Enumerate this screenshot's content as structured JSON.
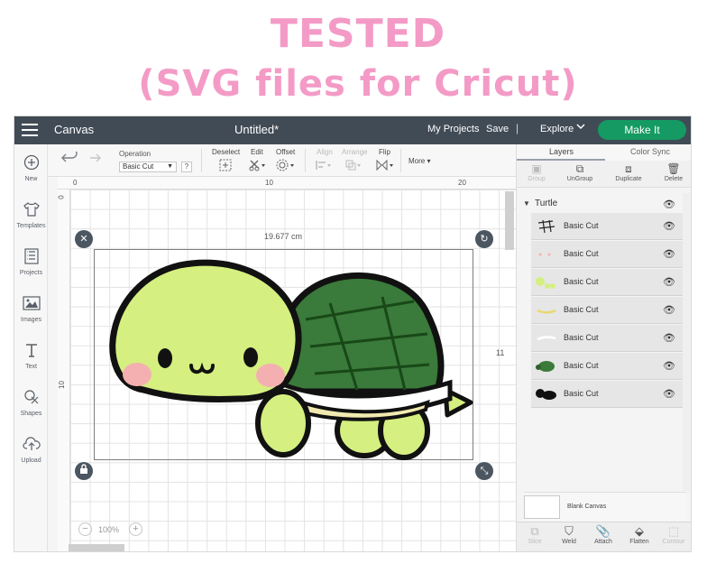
{
  "headline": {
    "line1": "TESTED",
    "line2": "(SVG files for Cricut)",
    "color": "#f39bc6"
  },
  "topbar": {
    "menu_icon": "hamburger-icon",
    "section": "Canvas",
    "document_title": "Untitled*",
    "my_projects": "My Projects",
    "save": "Save",
    "separator": "|",
    "explore": "Explore",
    "make_it": "Make It",
    "make_it_color": "#149a62",
    "bar_color": "#414b56"
  },
  "toolbar": {
    "operation_label": "Operation",
    "operation_value": "Basic Cut",
    "help": "?",
    "deselect": "Deselect",
    "edit": "Edit",
    "offset": "Offset",
    "align": "Align",
    "arrange": "Arrange",
    "flip": "Flip",
    "more": "More"
  },
  "sidebar": {
    "items": [
      {
        "label": "New",
        "icon": "plus-circle-icon"
      },
      {
        "label": "Templates",
        "icon": "shirt-icon"
      },
      {
        "label": "Projects",
        "icon": "grid-icon"
      },
      {
        "label": "Images",
        "icon": "image-icon"
      },
      {
        "label": "Text",
        "icon": "text-t-icon"
      },
      {
        "label": "Shapes",
        "icon": "shapes-icon"
      },
      {
        "label": "Upload",
        "icon": "cloud-upload-icon"
      }
    ]
  },
  "rulers": {
    "top": [
      "0",
      "10",
      "20"
    ],
    "left": [
      "0",
      "10"
    ]
  },
  "canvas": {
    "width_readout": "19.677 cm",
    "height_readout": "11",
    "zoom": "100%"
  },
  "panel": {
    "tabs": [
      "Layers",
      "Color Sync"
    ],
    "actions": [
      "Group",
      "UnGroup",
      "Duplicate",
      "Delete"
    ],
    "group_name": "Turtle",
    "layers": [
      {
        "name": "Basic Cut",
        "thumb": "grid-lines"
      },
      {
        "name": "Basic Cut",
        "thumb": "pink-dots"
      },
      {
        "name": "Basic Cut",
        "thumb": "green-blobs"
      },
      {
        "name": "Basic Cut",
        "thumb": "yellow-stripe"
      },
      {
        "name": "Basic Cut",
        "thumb": "white-stripe"
      },
      {
        "name": "Basic Cut",
        "thumb": "dark-green-shell"
      },
      {
        "name": "Basic Cut",
        "thumb": "black-silhouette"
      }
    ],
    "blank_canvas": "Blank Canvas",
    "bottom_actions": [
      "Slice",
      "Weld",
      "Attach",
      "Flatten",
      "Contour"
    ]
  }
}
